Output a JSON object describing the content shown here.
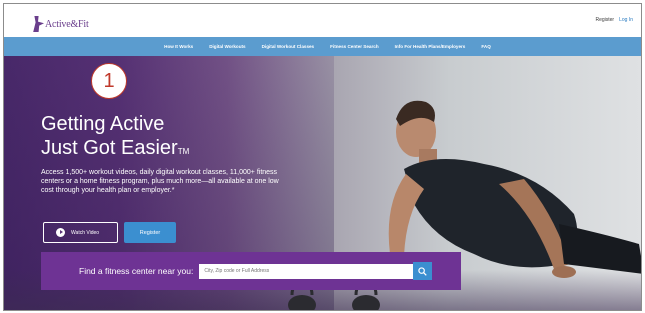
{
  "header": {
    "logo_text": "Active&Fit",
    "register_label": "Register",
    "login_label": "Log In"
  },
  "nav": {
    "items": [
      {
        "label": "How It Works"
      },
      {
        "label": "Digital Workouts"
      },
      {
        "label": "Digital Workout Classes"
      },
      {
        "label": "Fitness Center Search"
      },
      {
        "label": "Info For Health Plans/Employers"
      },
      {
        "label": "FAQ"
      }
    ]
  },
  "hero": {
    "marker": "1",
    "headline_line1": "Getting Active",
    "headline_line2": "Just Got Easier",
    "trademark": "TM",
    "subcopy": "Access 1,500+ workout videos, daily digital workout classes, 11,000+ fitness centers or a home fitness program, plus much more—all available at one low cost through your health plan or employer.*",
    "watch_video_label": "Watch Video",
    "register_button_label": "Register"
  },
  "finder": {
    "label": "Find a fitness center near you:",
    "placeholder": "City, Zip code or Full Address",
    "search_icon": "search-icon"
  },
  "colors": {
    "brand_purple": "#6e3394",
    "nav_blue": "#5b9ccf",
    "button_blue": "#3b8fd0",
    "marker_red": "#c0392b"
  }
}
